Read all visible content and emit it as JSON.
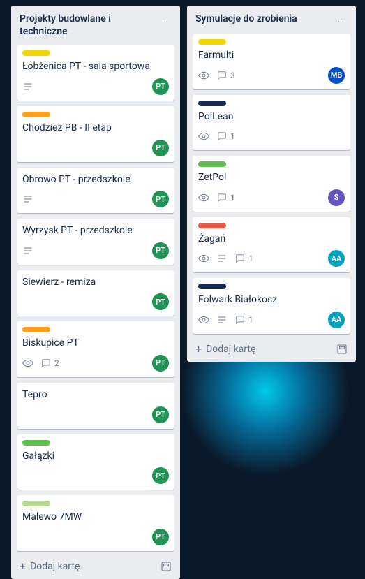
{
  "labelColors": {
    "yellow": "#f2d600",
    "orange": "#ff9f1a",
    "green": "#61bd4f",
    "lightgreen": "#b3d98f",
    "darkblue": "#172b4d",
    "red": "#eb5a46"
  },
  "avatarColors": {
    "PT": "#1f9455",
    "MB": "#0052cc",
    "S": "#6554c0",
    "AA": "#00a3bf"
  },
  "addCardLabel": "Dodaj kartę",
  "lists": [
    {
      "title": "Projekty budowlane i techniczne",
      "cards": [
        {
          "title": "Łobżenica PT - sala sportowa",
          "label": "yellow",
          "hasDesc": true,
          "avatar": "PT"
        },
        {
          "title": "Chodzież PB - II etap",
          "label": "orange",
          "avatar": "PT"
        },
        {
          "title": "Obrowo PT - przedszkole",
          "hasDesc": true,
          "avatar": "PT"
        },
        {
          "title": "Wyrzysk PT - przedszkole",
          "hasDesc": true,
          "avatar": "PT"
        },
        {
          "title": "Siewierz - remiza",
          "avatar": "PT"
        },
        {
          "title": "Biskupice PT",
          "label": "orange",
          "watching": true,
          "comments": 2,
          "avatar": "PT"
        },
        {
          "title": "Tepro",
          "avatar": "PT"
        },
        {
          "title": "Gałązki",
          "label": "green",
          "avatar": "PT"
        },
        {
          "title": "Malewo 7MW",
          "label": "lightgreen",
          "avatar": "PT"
        }
      ]
    },
    {
      "title": "Symulacje do zrobienia",
      "cards": [
        {
          "title": "Farmulti",
          "label": "yellow",
          "watching": true,
          "comments": 3,
          "avatar": "MB"
        },
        {
          "title": "PolLean",
          "label": "darkblue",
          "watching": true,
          "comments": 1
        },
        {
          "title": "ZetPol",
          "label": "green",
          "watching": true,
          "comments": 1,
          "avatar": "S"
        },
        {
          "title": "Żagań",
          "label": "red",
          "watching": true,
          "hasDesc": true,
          "comments": 1,
          "avatar": "AA"
        },
        {
          "title": "Folwark Białokosz",
          "label": "darkblue",
          "watching": true,
          "hasDesc": true,
          "comments": 1,
          "avatar": "AA"
        }
      ]
    }
  ]
}
